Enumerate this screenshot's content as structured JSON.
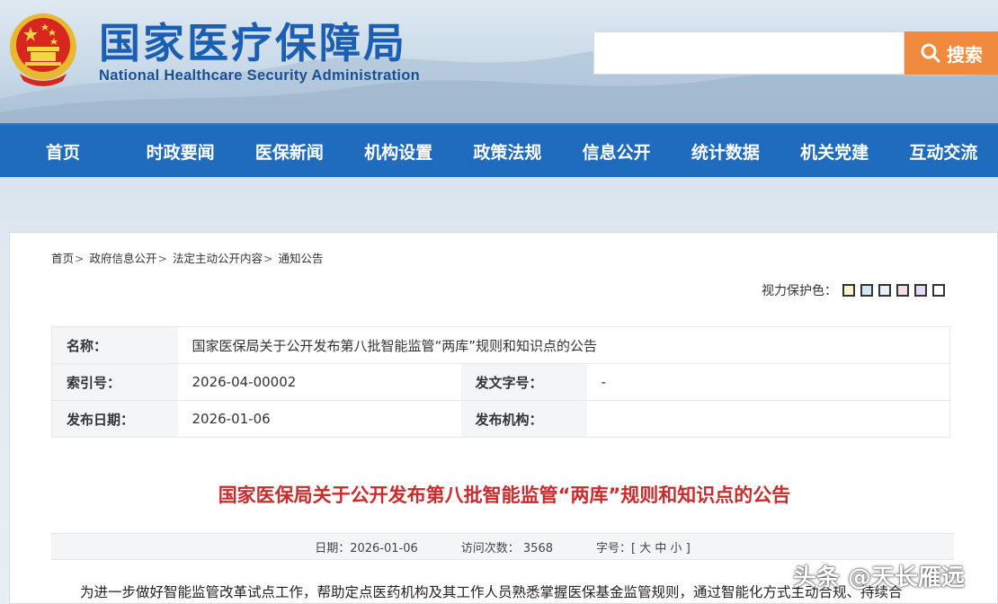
{
  "header": {
    "title": "国家医疗保障局",
    "subtitle": "National Healthcare Security Administration",
    "search_placeholder": "",
    "search_button": "搜索"
  },
  "nav": [
    "首页",
    "时政要闻",
    "医保新闻",
    "机构设置",
    "政策法规",
    "信息公开",
    "统计数据",
    "机关党建",
    "互动交流"
  ],
  "breadcrumb": [
    "首页",
    "政府信息公开",
    "法定主动公开内容",
    "通知公告"
  ],
  "eye_care": {
    "label": "视力保护色：",
    "colors": [
      "#f8f4c8",
      "#cfe8f5",
      "#e8eef2",
      "#f5dde6",
      "#e4dcf4",
      "#ffffff"
    ]
  },
  "meta": {
    "name_label": "名称：",
    "name_value": "国家医保局关于公开发布第八批智能监管“两库”规则和知识点的公告",
    "index_label": "索引号：",
    "index_value": "2026-04-00002",
    "doc_no_label": "发文字号：",
    "doc_no_value": "-",
    "date_label": "发布日期：",
    "date_value": "2026-01-06",
    "org_label": "发布机构：",
    "org_value": ""
  },
  "article": {
    "title": "国家医保局关于公开发布第八批智能监管“两库”规则和知识点的公告",
    "date_text": "日期：2026-01-06",
    "visits_text": "访问次数： 3568",
    "font_size_label": "字号：[",
    "font_sizes": [
      "大",
      "中",
      "小"
    ],
    "font_size_end": "]",
    "body_first_line": "为进一步做好智能监管改革试点工作，帮助定点医药机构及其工作人员熟悉掌握医保基金监管规则，通过智能化方式主动合规、持续合"
  },
  "watermark": "头条 @天长雁远",
  "colors": {
    "nav_bg": "#1f6bbd",
    "title_blue": "#1b5fb3",
    "doc_title_red": "#c82c2c",
    "search_orange": "#f08a3e"
  }
}
